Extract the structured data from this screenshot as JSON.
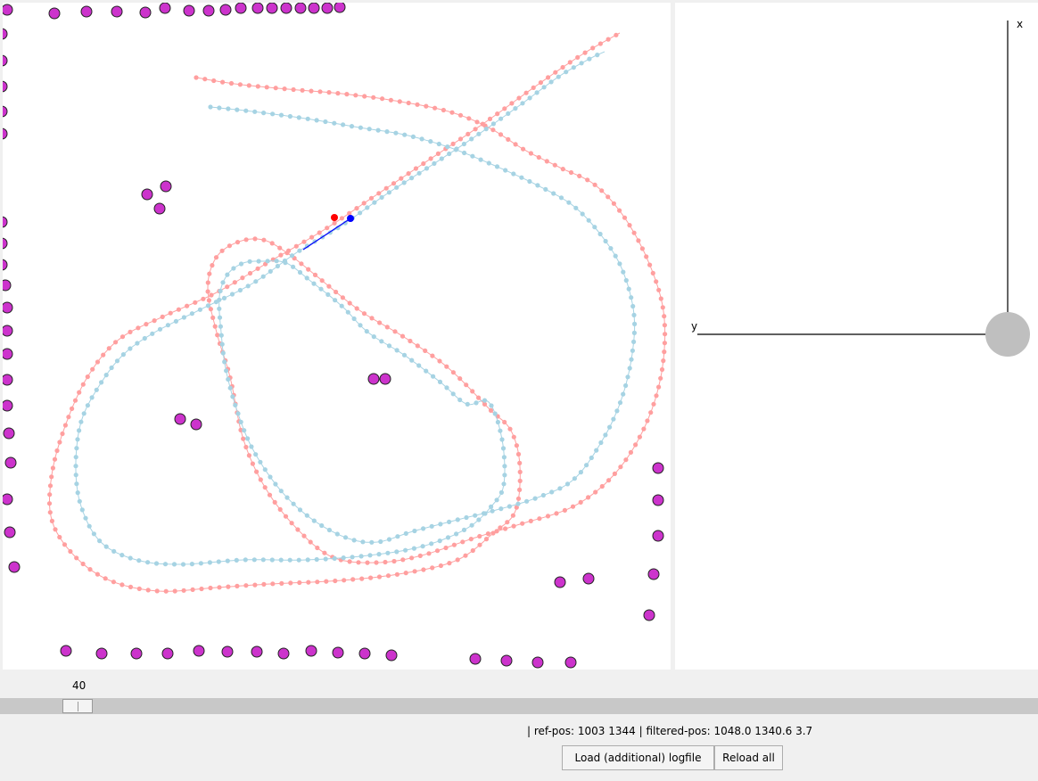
{
  "slider": {
    "value": "40",
    "fraction": 0.06
  },
  "status": {
    "text": "| ref-pos: 1003 1344 | filtered-pos: 1048.0 1340.6 3.7"
  },
  "buttons": {
    "load_label": "Load (additional) logfile",
    "reload_label": "Reload all"
  },
  "axes": {
    "x_label": "x",
    "y_label": "y"
  },
  "colors": {
    "landmark": "#cc33cc",
    "ref_track": "#ff9f9f",
    "filtered_track": "#a6d3e3",
    "ref_marker": "#ff0000",
    "filtered_marker": "#0000ff",
    "robot": "#bfbfbf"
  }
}
